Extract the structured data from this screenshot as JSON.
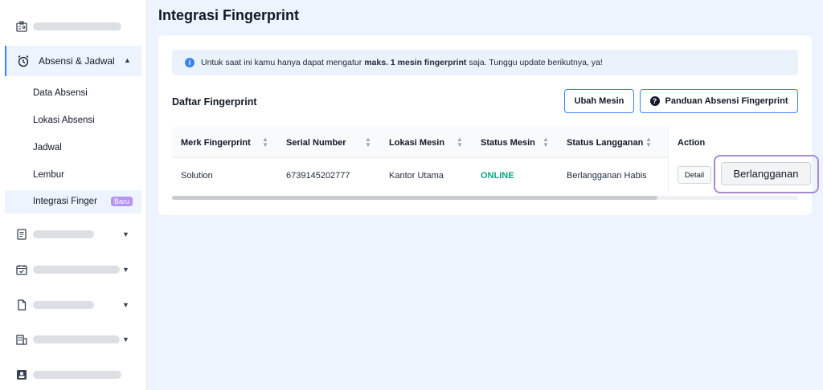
{
  "sidebar": {
    "active_group": {
      "label": "Absensi & Jadwal",
      "icon": "alarm-clock-icon"
    },
    "sub_items": [
      {
        "label": "Data Absensi"
      },
      {
        "label": "Lokasi Absensi"
      },
      {
        "label": "Jadwal"
      },
      {
        "label": "Lembur"
      }
    ],
    "active_sub": {
      "label": "Integrasi Finger",
      "badge": "Baru"
    },
    "collapsed_icons": [
      "id-card-icon",
      "document-icon",
      "calendar-check-icon",
      "file-icon",
      "building-icon",
      "badge-icon"
    ]
  },
  "page": {
    "title": "Integrasi Fingerprint"
  },
  "info": {
    "prefix": "Untuk saat ini kamu hanya dapat mengatur",
    "bold": "maks. 1 mesin fingerprint",
    "suffix": "saja. Tunggu update berikutnya, ya!"
  },
  "list": {
    "title": "Daftar Fingerprint",
    "ubah_label": "Ubah Mesin",
    "panduan_label": "Panduan Absensi Fingerprint"
  },
  "table": {
    "columns": [
      "Merk Fingerprint",
      "Serial Number",
      "Lokasi Mesin",
      "Status Mesin",
      "Status Langganan",
      "Action"
    ],
    "rows": [
      {
        "merk": "Solution",
        "serial": "6739145202777",
        "lokasi": "Kantor Utama",
        "status_mesin": "ONLINE",
        "status_langganan": "Berlangganan Habis"
      }
    ],
    "detail_label": "Detail",
    "subscribe_label": "Berlangganan"
  },
  "colors": {
    "accent": "#3b82f6",
    "online": "#10a37f",
    "badge": "#b794f4",
    "highlight": "#a78bce"
  }
}
